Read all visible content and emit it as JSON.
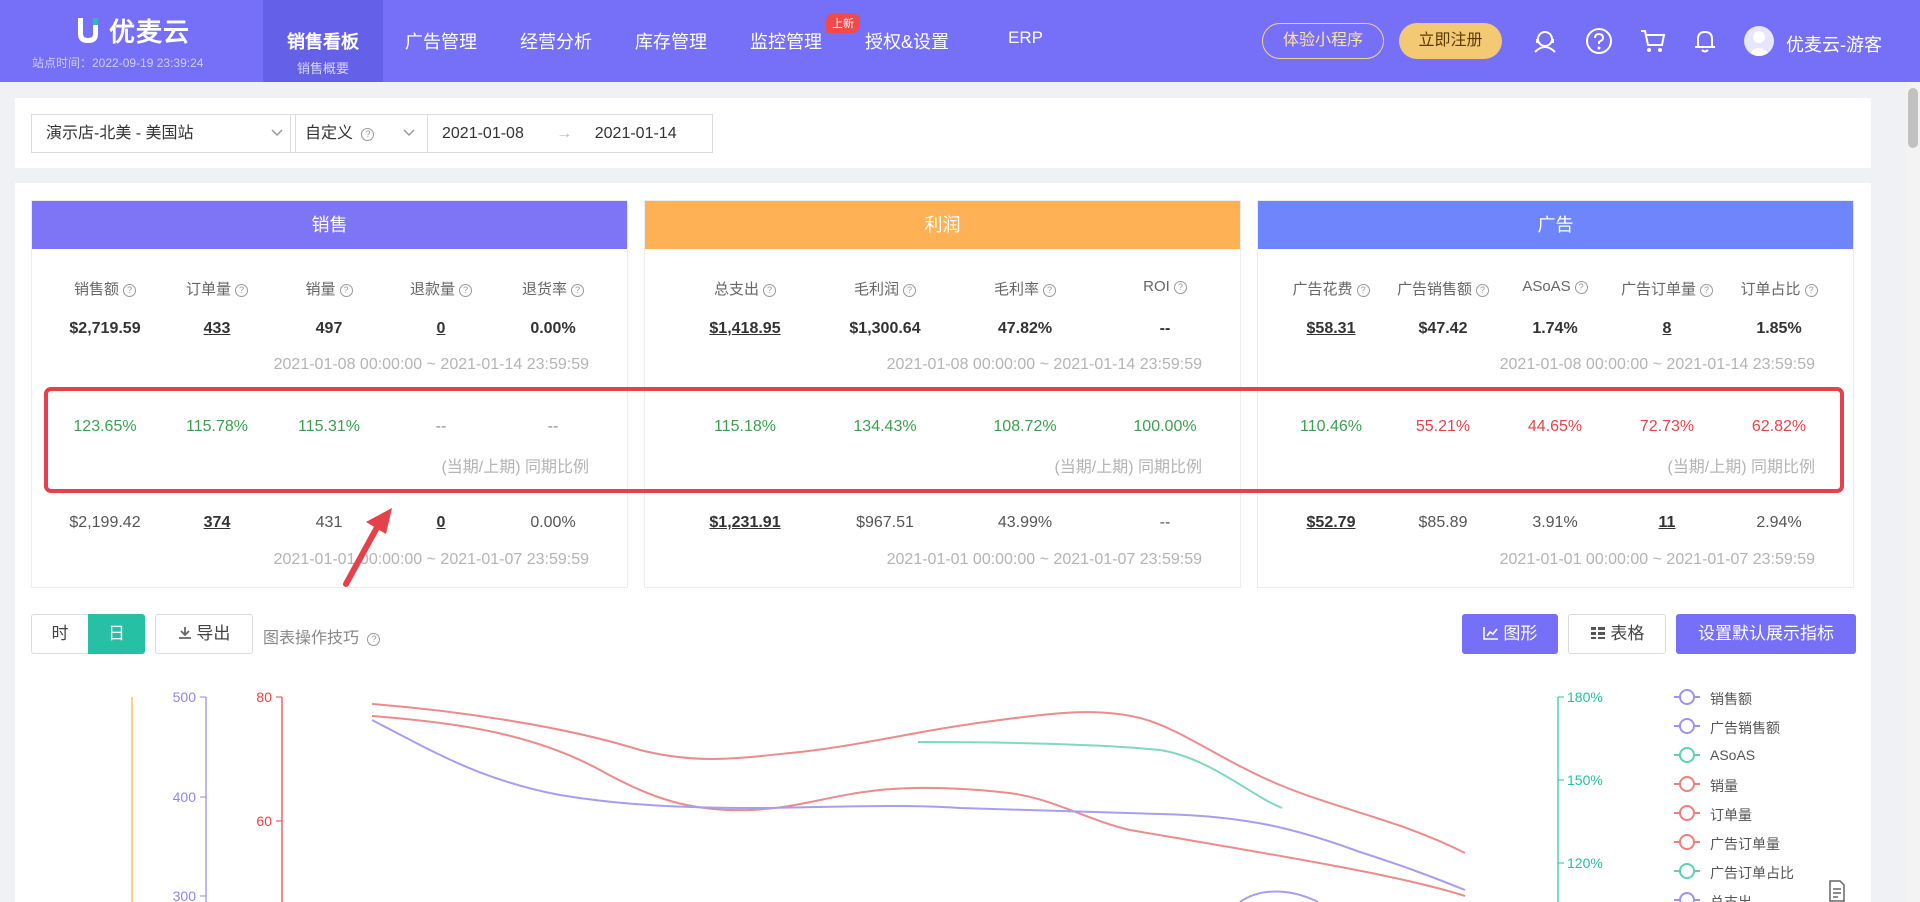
{
  "header": {
    "logo": "优麦云",
    "site_time": "站点时间：2022-09-19 23:39:24",
    "active_nav": {
      "label": "销售看板",
      "sub": "销售概要"
    },
    "nav_items": [
      "广告管理",
      "经营分析",
      "库存管理",
      "监控管理",
      "授权&设置",
      "ERP"
    ],
    "new_badge": "上新",
    "mini_program": "体验小程序",
    "register": "立即注册",
    "user_name": "优麦云-游客"
  },
  "filters": {
    "store": "演示店-北美 - 美国站",
    "date_mode": "自定义",
    "date_start": "2021-01-08",
    "date_sep": "→",
    "date_end": "2021-01-14"
  },
  "cards": [
    {
      "title": "销售",
      "color": "#7d75f5",
      "metrics": [
        "销售额",
        "订单量",
        "销量",
        "退款量",
        "退货率"
      ],
      "current": [
        "$2,719.59",
        "433",
        "497",
        "0",
        "0.00%"
      ],
      "current_range": "2021-01-08 00:00:00 ~ 2021-01-14 23:59:59",
      "ratios": [
        "123.65%",
        "115.78%",
        "115.31%",
        "--",
        "--"
      ],
      "ratio_note": "(当期/上期) 同期比例",
      "previous": [
        "$2,199.42",
        "374",
        "431",
        "0",
        "0.00%"
      ],
      "previous_range": "2021-01-01 00:00:00 ~ 2021-01-07 23:59:59"
    },
    {
      "title": "利润",
      "color": "#ffb155",
      "metrics": [
        "总支出",
        "毛利润",
        "毛利率",
        "ROI"
      ],
      "current": [
        "$1,418.95",
        "$1,300.64",
        "47.82%",
        "--"
      ],
      "current_range": "2021-01-08 00:00:00 ~ 2021-01-14 23:59:59",
      "ratios": [
        "115.18%",
        "134.43%",
        "108.72%",
        "100.00%"
      ],
      "ratio_note": "(当期/上期) 同期比例",
      "previous": [
        "$1,231.91",
        "$967.51",
        "43.99%",
        "--"
      ],
      "previous_range": "2021-01-01 00:00:00 ~ 2021-01-07 23:59:59"
    },
    {
      "title": "广告",
      "color": "#6e85fb",
      "metrics": [
        "广告花费",
        "广告销售额",
        "ASoAS",
        "广告订单量",
        "订单占比"
      ],
      "current": [
        "$58.31",
        "$47.42",
        "1.74%",
        "8",
        "1.85%"
      ],
      "current_range": "2021-01-08 00:00:00 ~ 2021-01-14 23:59:59",
      "ratios": [
        "110.46%",
        "55.21%",
        "44.65%",
        "72.73%",
        "62.82%"
      ],
      "ratio_note": "(当期/上期) 同期比例",
      "previous": [
        "$52.79",
        "$85.89",
        "3.91%",
        "11",
        "2.94%"
      ],
      "previous_range": "2021-01-01 00:00:00 ~ 2021-01-07 23:59:59"
    }
  ],
  "toolbar": {
    "hour": "时",
    "day": "日",
    "export": "导出",
    "tips": "图表操作技巧",
    "graph": "图形",
    "table": "表格",
    "set_default": "设置默认展示指标"
  },
  "chart_data": {
    "type": "line",
    "axes": {
      "left1": {
        "ticks": [
          "500",
          "400",
          "300"
        ],
        "color": "#8f86f0"
      },
      "left2": {
        "ticks": [
          "80",
          "60"
        ],
        "color": "#e8424a"
      },
      "right": {
        "ticks": [
          "180%",
          "150%",
          "120%"
        ],
        "color": "#26c1a4"
      }
    },
    "legend": [
      {
        "name": "销售额",
        "color": "#9b93f2"
      },
      {
        "name": "广告销售额",
        "color": "#9b93f2"
      },
      {
        "name": "ASoAS",
        "color": "#5fd0b6"
      },
      {
        "name": "销量",
        "color": "#ef7f7f"
      },
      {
        "name": "订单量",
        "color": "#ef7f7f"
      },
      {
        "name": "广告订单量",
        "color": "#ef7f7f"
      },
      {
        "name": "广告订单占比",
        "color": "#5fd0b6"
      },
      {
        "name": "总支出",
        "color": "#9b93f2"
      }
    ]
  }
}
